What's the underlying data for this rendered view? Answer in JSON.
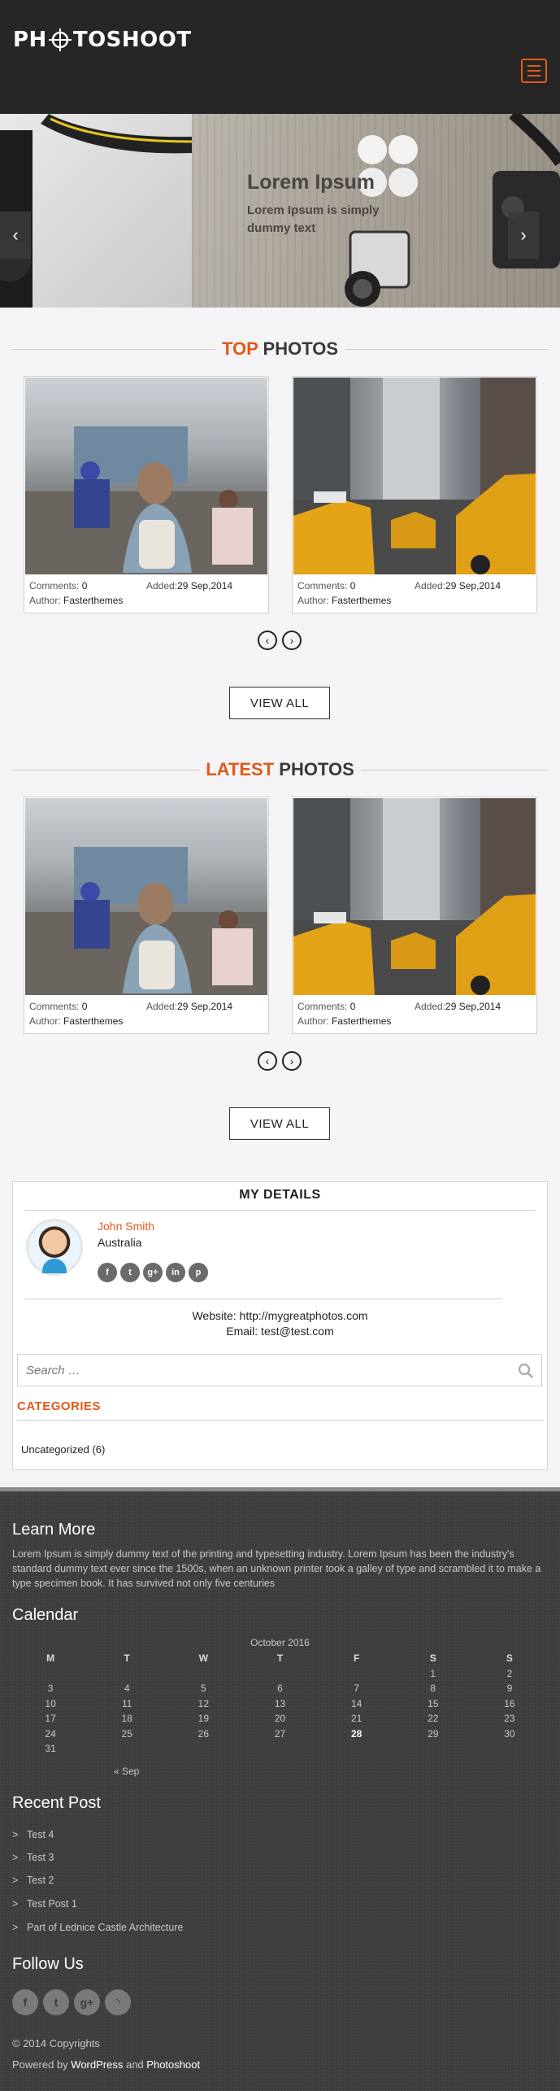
{
  "header": {
    "logo_prefix": "PH",
    "logo_suffix": "TOSHOOT",
    "menu_icon": "hamburger-icon"
  },
  "slider": {
    "title": "Lorem Ipsum",
    "text": "Lorem Ipsum is simply dummy text",
    "prev_icon": "chevron-left-icon",
    "next_icon": "chevron-right-icon",
    "prev_glyph": "‹",
    "next_glyph": "›"
  },
  "top_photos": {
    "heading_accent": "TOP",
    "heading_rest": "PHOTOS",
    "cards": [
      {
        "comments_label": "Comments:",
        "comments": "0",
        "added_label": "Added:",
        "added": "29 Sep,2014",
        "author_label": "Author:",
        "author": "Fasterthemes"
      },
      {
        "comments_label": "Comments:",
        "comments": "0",
        "added_label": "Added:",
        "added": "29 Sep,2014",
        "author_label": "Author:",
        "author": "Fasterthemes"
      }
    ],
    "view_all": "VIEW ALL"
  },
  "latest_photos": {
    "heading_accent": "LATEST",
    "heading_rest": "PHOTOS",
    "cards": [
      {
        "comments_label": "Comments:",
        "comments": "0",
        "added_label": "Added:",
        "added": "29 Sep,2014",
        "author_label": "Author:",
        "author": "Fasterthemes"
      },
      {
        "comments_label": "Comments:",
        "comments": "0",
        "added_label": "Added:",
        "added": "29 Sep,2014",
        "author_label": "Author:",
        "author": "Fasterthemes"
      }
    ],
    "view_all": "VIEW ALL"
  },
  "pager": {
    "prev": "‹",
    "next": "›"
  },
  "details": {
    "heading": "MY DETAILS",
    "name": "John Smith",
    "country": "Australia",
    "socials": [
      {
        "icon": "facebook-icon",
        "glyph": "f"
      },
      {
        "icon": "twitter-icon",
        "glyph": "t"
      },
      {
        "icon": "google-plus-icon",
        "glyph": "g+"
      },
      {
        "icon": "linkedin-icon",
        "glyph": "in"
      },
      {
        "icon": "pinterest-icon",
        "glyph": "p"
      }
    ],
    "website": "Website: http://mygreatphotos.com",
    "email": "Email: test@test.com",
    "search_placeholder": "Search …",
    "categories_heading": "CATEGORIES",
    "category_item": "Uncategorized (6)"
  },
  "footer": {
    "learn_more_heading": "Learn More",
    "learn_more_text": "Lorem Ipsum is simply dummy text of the printing and typesetting industry. Lorem Ipsum has been the industry's standard dummy text ever since the 1500s, when an unknown printer took a galley of type and scrambled it to make a type specimen book. It has survived not only five centuries",
    "calendar_heading": "Calendar",
    "calendar_caption": "October 2016",
    "calendar_days": [
      "M",
      "T",
      "W",
      "T",
      "F",
      "S",
      "S"
    ],
    "calendar_rows": [
      [
        "",
        "",
        "",
        "",
        "",
        "1",
        "2"
      ],
      [
        "3",
        "4",
        "5",
        "6",
        "7",
        "8",
        "9"
      ],
      [
        "10",
        "11",
        "12",
        "13",
        "14",
        "15",
        "16"
      ],
      [
        "17",
        "18",
        "19",
        "20",
        "21",
        "22",
        "23"
      ],
      [
        "24",
        "25",
        "26",
        "27",
        "28",
        "29",
        "30"
      ],
      [
        "31",
        "",
        "",
        "",
        "",
        "",
        ""
      ]
    ],
    "calendar_today": "28",
    "calendar_prev": "« Sep",
    "recent_heading": "Recent Post",
    "recent_posts": [
      "Test 4",
      "Test 3",
      "Test 2",
      "Test Post 1",
      "Part of Lednice Castle Architecture"
    ],
    "follow_heading": "Follow Us",
    "follow": [
      {
        "icon": "facebook-icon",
        "glyph": "f"
      },
      {
        "icon": "twitter-icon",
        "glyph": "t"
      },
      {
        "icon": "google-plus-icon",
        "glyph": "g+"
      },
      {
        "icon": "rss-icon",
        "glyph": "◝"
      }
    ],
    "copyright": "© 2014 Copyrights",
    "powered_prefix": "Powered by",
    "powered_wp": "WordPress",
    "powered_and": "and",
    "powered_theme": "Photoshoot"
  },
  "colors": {
    "accent": "#e05a1a",
    "header_bg": "#262626",
    "footer_bg": "#3d3d3d"
  }
}
